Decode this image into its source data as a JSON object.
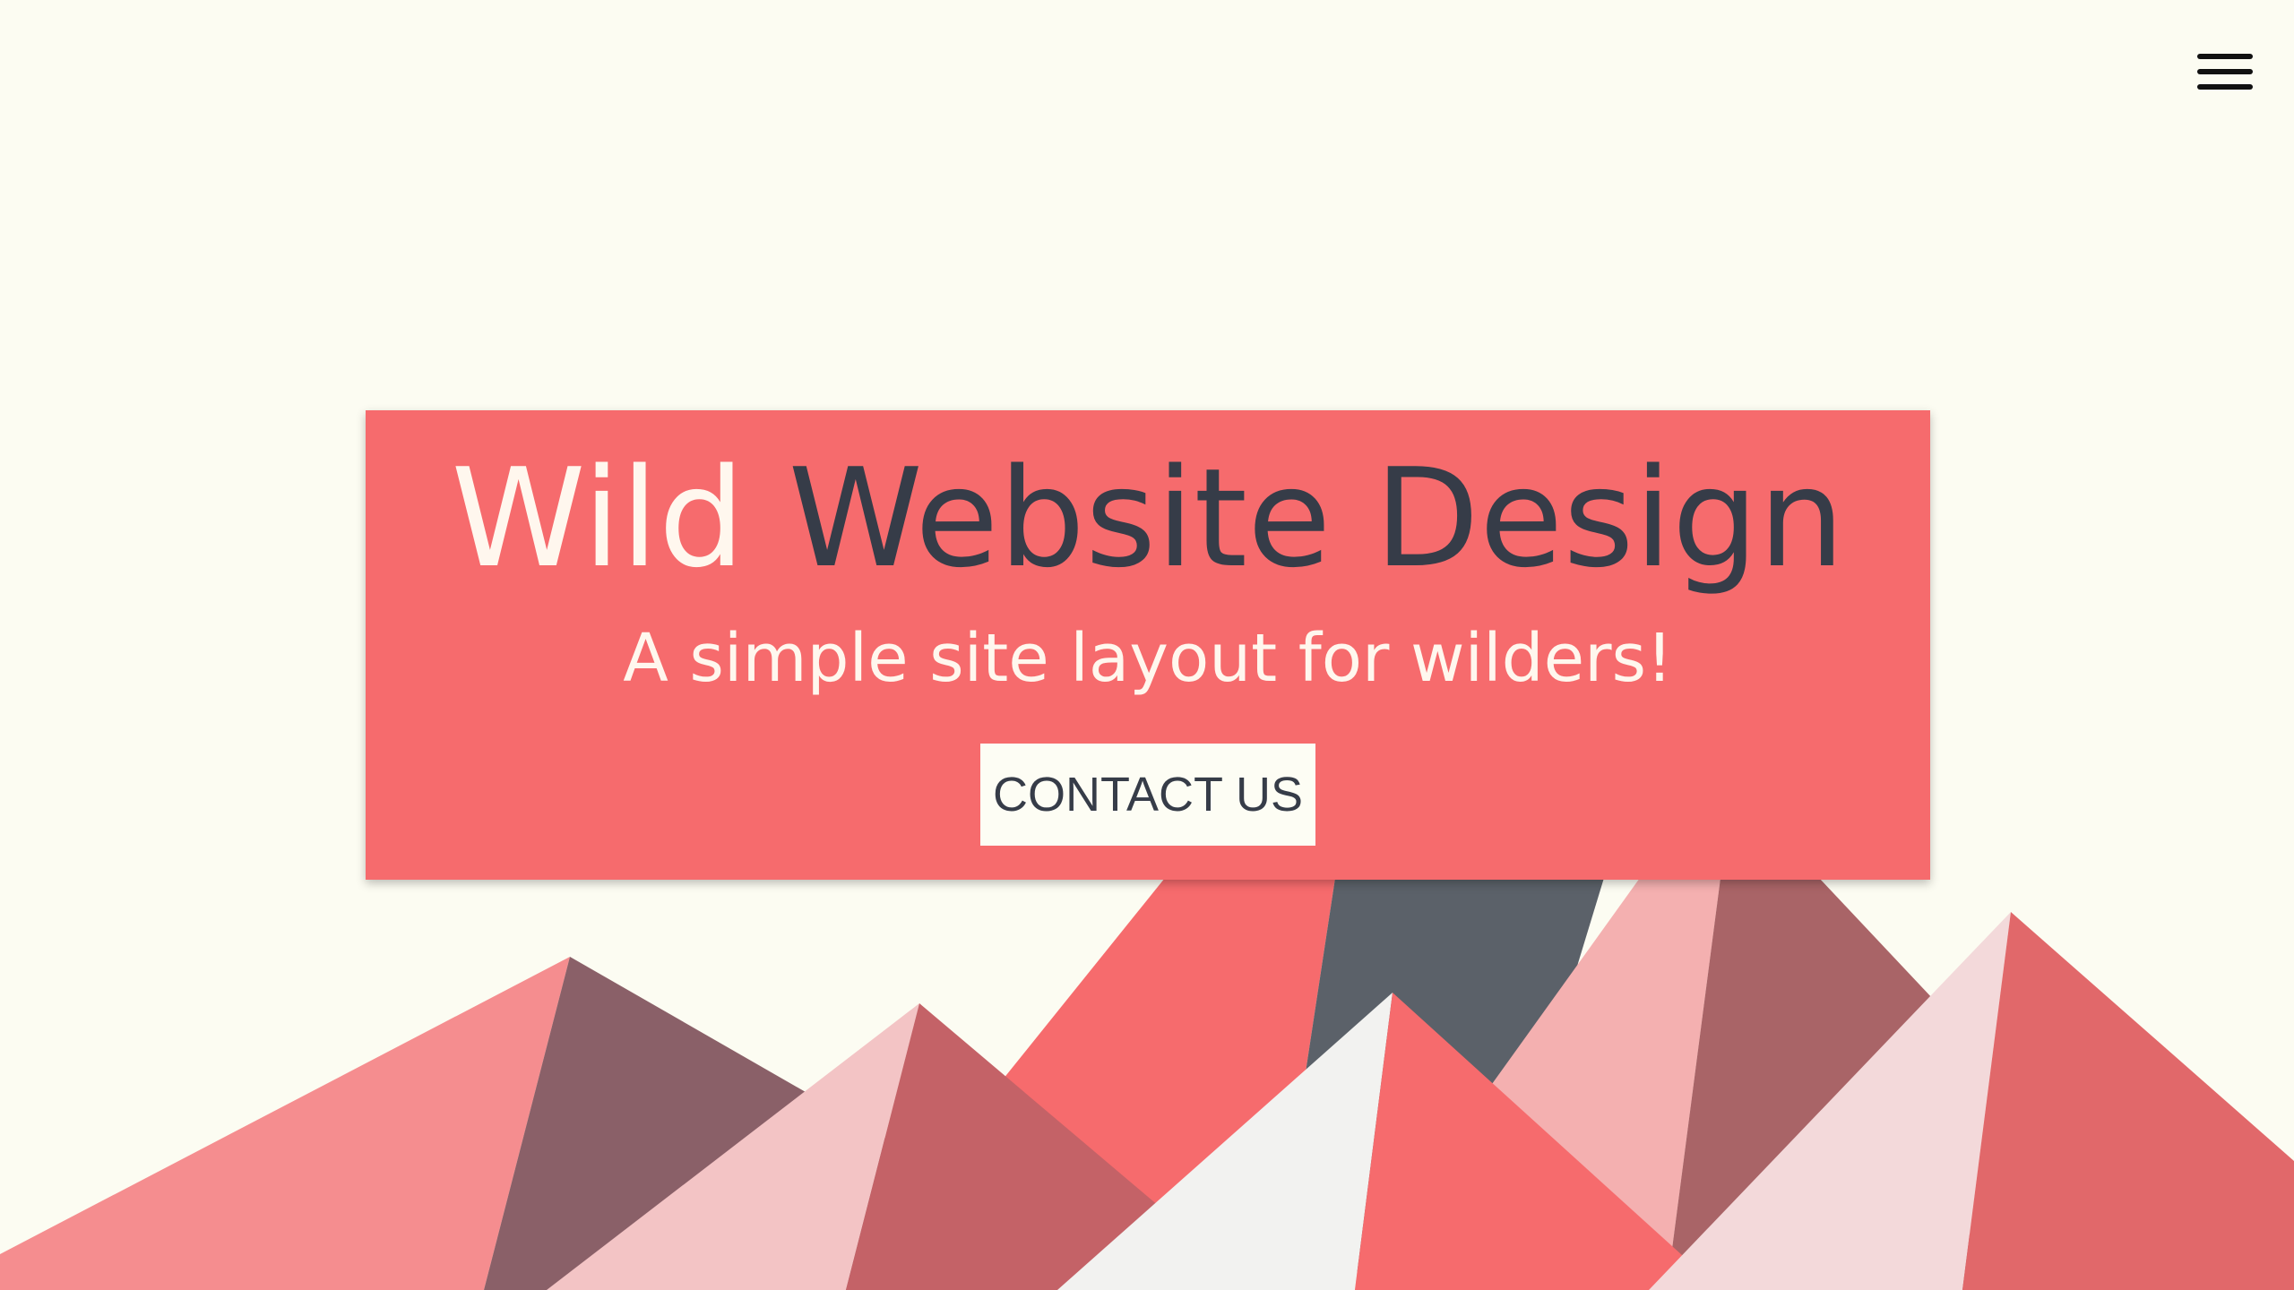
{
  "header": {
    "menu_icon": "hamburger-menu-icon"
  },
  "hero": {
    "title_first_word": "Wild",
    "title_rest": "Website Design",
    "subtitle": "A simple site layout for wilders!",
    "contact_label": "CONTACT US"
  },
  "colors": {
    "background": "#fcfcf2",
    "card": "#f66b6d",
    "title_dark": "#363c48",
    "title_light": "#fff7ee",
    "mountain_dark": "#5b6169",
    "mountain_coral": "#f66b6d",
    "mountain_pink": "#f58d8f",
    "mountain_light_pink": "#f4b0b0",
    "mountain_pale": "#f3d9da",
    "mountain_white": "#f2f2f0",
    "mountain_brown": "#8a6068",
    "mountain_rose": "#c46267"
  },
  "illustration": {
    "name": "mountains-illustration"
  }
}
